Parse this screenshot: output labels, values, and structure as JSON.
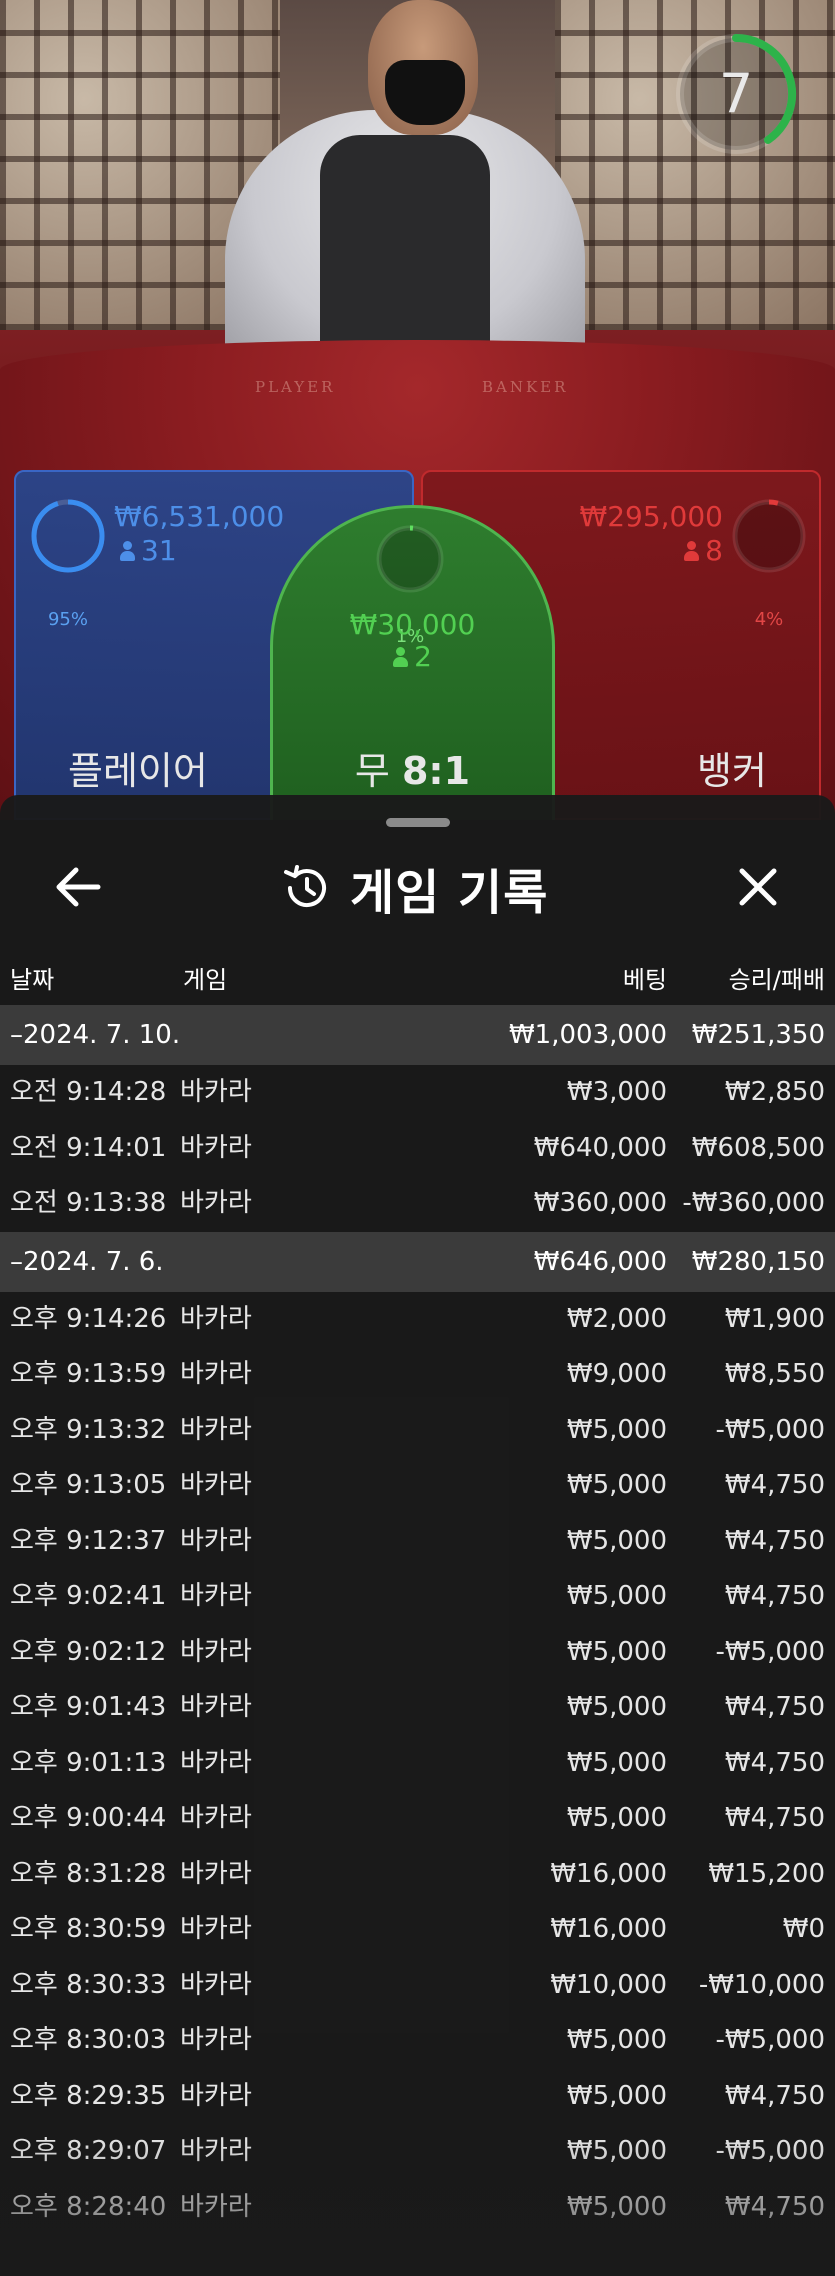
{
  "video": {
    "felt_player": "PLAYER",
    "felt_banker": "BANKER",
    "timer": "7"
  },
  "bets": {
    "player": {
      "percent": "95%",
      "amount": "₩6,531,000",
      "count": "31",
      "label": "플레이어",
      "color": "#3a7bd5"
    },
    "tie": {
      "percent": "1%",
      "amount": "₩30,000",
      "count": "2",
      "label_prefix": "무",
      "label_odds": "8:1",
      "color": "#3ec43e"
    },
    "banker": {
      "percent": "4%",
      "amount": "₩295,000",
      "count": "8",
      "label": "뱅커",
      "color": "#d62b2e"
    }
  },
  "panel": {
    "title": "게임 기록",
    "back_icon": "arrow-left-icon",
    "history_icon": "history-icon",
    "close_icon": "close-icon",
    "columns": {
      "date": "날짜",
      "game": "게임",
      "bet": "베팅",
      "result": "승리/패배"
    }
  },
  "history": [
    {
      "type": "date",
      "date": "–2024. 7. 10.",
      "bet": "₩1,003,000",
      "result": "₩251,350"
    },
    {
      "type": "game",
      "time": "오전 9:14:28",
      "game": "바카라",
      "bet": "₩3,000",
      "result": "₩2,850"
    },
    {
      "type": "game",
      "time": "오전 9:14:01",
      "game": "바카라",
      "bet": "₩640,000",
      "result": "₩608,500"
    },
    {
      "type": "game",
      "time": "오전 9:13:38",
      "game": "바카라",
      "bet": "₩360,000",
      "result": "-₩360,000"
    },
    {
      "type": "date",
      "date": "–2024. 7. 6.",
      "bet": "₩646,000",
      "result": "₩280,150"
    },
    {
      "type": "game",
      "time": "오후 9:14:26",
      "game": "바카라",
      "bet": "₩2,000",
      "result": "₩1,900"
    },
    {
      "type": "game",
      "time": "오후 9:13:59",
      "game": "바카라",
      "bet": "₩9,000",
      "result": "₩8,550"
    },
    {
      "type": "game",
      "time": "오후 9:13:32",
      "game": "바카라",
      "bet": "₩5,000",
      "result": "-₩5,000"
    },
    {
      "type": "game",
      "time": "오후 9:13:05",
      "game": "바카라",
      "bet": "₩5,000",
      "result": "₩4,750"
    },
    {
      "type": "game",
      "time": "오후 9:12:37",
      "game": "바카라",
      "bet": "₩5,000",
      "result": "₩4,750"
    },
    {
      "type": "game",
      "time": "오후 9:02:41",
      "game": "바카라",
      "bet": "₩5,000",
      "result": "₩4,750"
    },
    {
      "type": "game",
      "time": "오후 9:02:12",
      "game": "바카라",
      "bet": "₩5,000",
      "result": "-₩5,000"
    },
    {
      "type": "game",
      "time": "오후 9:01:43",
      "game": "바카라",
      "bet": "₩5,000",
      "result": "₩4,750"
    },
    {
      "type": "game",
      "time": "오후 9:01:13",
      "game": "바카라",
      "bet": "₩5,000",
      "result": "₩4,750"
    },
    {
      "type": "game",
      "time": "오후 9:00:44",
      "game": "바카라",
      "bet": "₩5,000",
      "result": "₩4,750"
    },
    {
      "type": "game",
      "time": "오후 8:31:28",
      "game": "바카라",
      "bet": "₩16,000",
      "result": "₩15,200"
    },
    {
      "type": "game",
      "time": "오후 8:30:59",
      "game": "바카라",
      "bet": "₩16,000",
      "result": "₩0"
    },
    {
      "type": "game",
      "time": "오후 8:30:33",
      "game": "바카라",
      "bet": "₩10,000",
      "result": "-₩10,000"
    },
    {
      "type": "game",
      "time": "오후 8:30:03",
      "game": "바카라",
      "bet": "₩5,000",
      "result": "-₩5,000"
    },
    {
      "type": "game",
      "time": "오후 8:29:35",
      "game": "바카라",
      "bet": "₩5,000",
      "result": "₩4,750"
    },
    {
      "type": "game",
      "time": "오후 8:29:07",
      "game": "바카라",
      "bet": "₩5,000",
      "result": "-₩5,000"
    },
    {
      "type": "game",
      "time": "오후 8:28:40",
      "game": "바카라",
      "bet": "₩5,000",
      "result": "₩4,750"
    }
  ]
}
